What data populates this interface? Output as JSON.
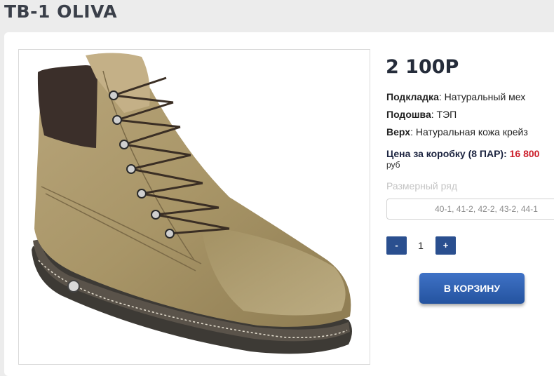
{
  "product": {
    "title": "ТВ-1 OLIVA",
    "price": "2 100Р",
    "image_alt": "boot-photo"
  },
  "properties": [
    {
      "label": "Подкладка",
      "value": "Натуральный мех"
    },
    {
      "label": "Подошва",
      "value": "ТЭП"
    },
    {
      "label": "Верх",
      "value": "Натуральная кожа крейз"
    }
  ],
  "box": {
    "label": "Цена за коробку (8 ПАР):",
    "amount": "16 800",
    "unit": "руб"
  },
  "sizes": {
    "label": "Размерный ряд",
    "value": "40-1, 41-2, 42-2, 43-2, 44-1"
  },
  "quantity": {
    "minus": "-",
    "value": "1",
    "plus": "+"
  },
  "cart": {
    "label": "В КОРЗИНУ"
  },
  "colors": {
    "accent": "#2a4f8f",
    "price_red": "#cc1f2b",
    "title": "#3a3f49"
  }
}
